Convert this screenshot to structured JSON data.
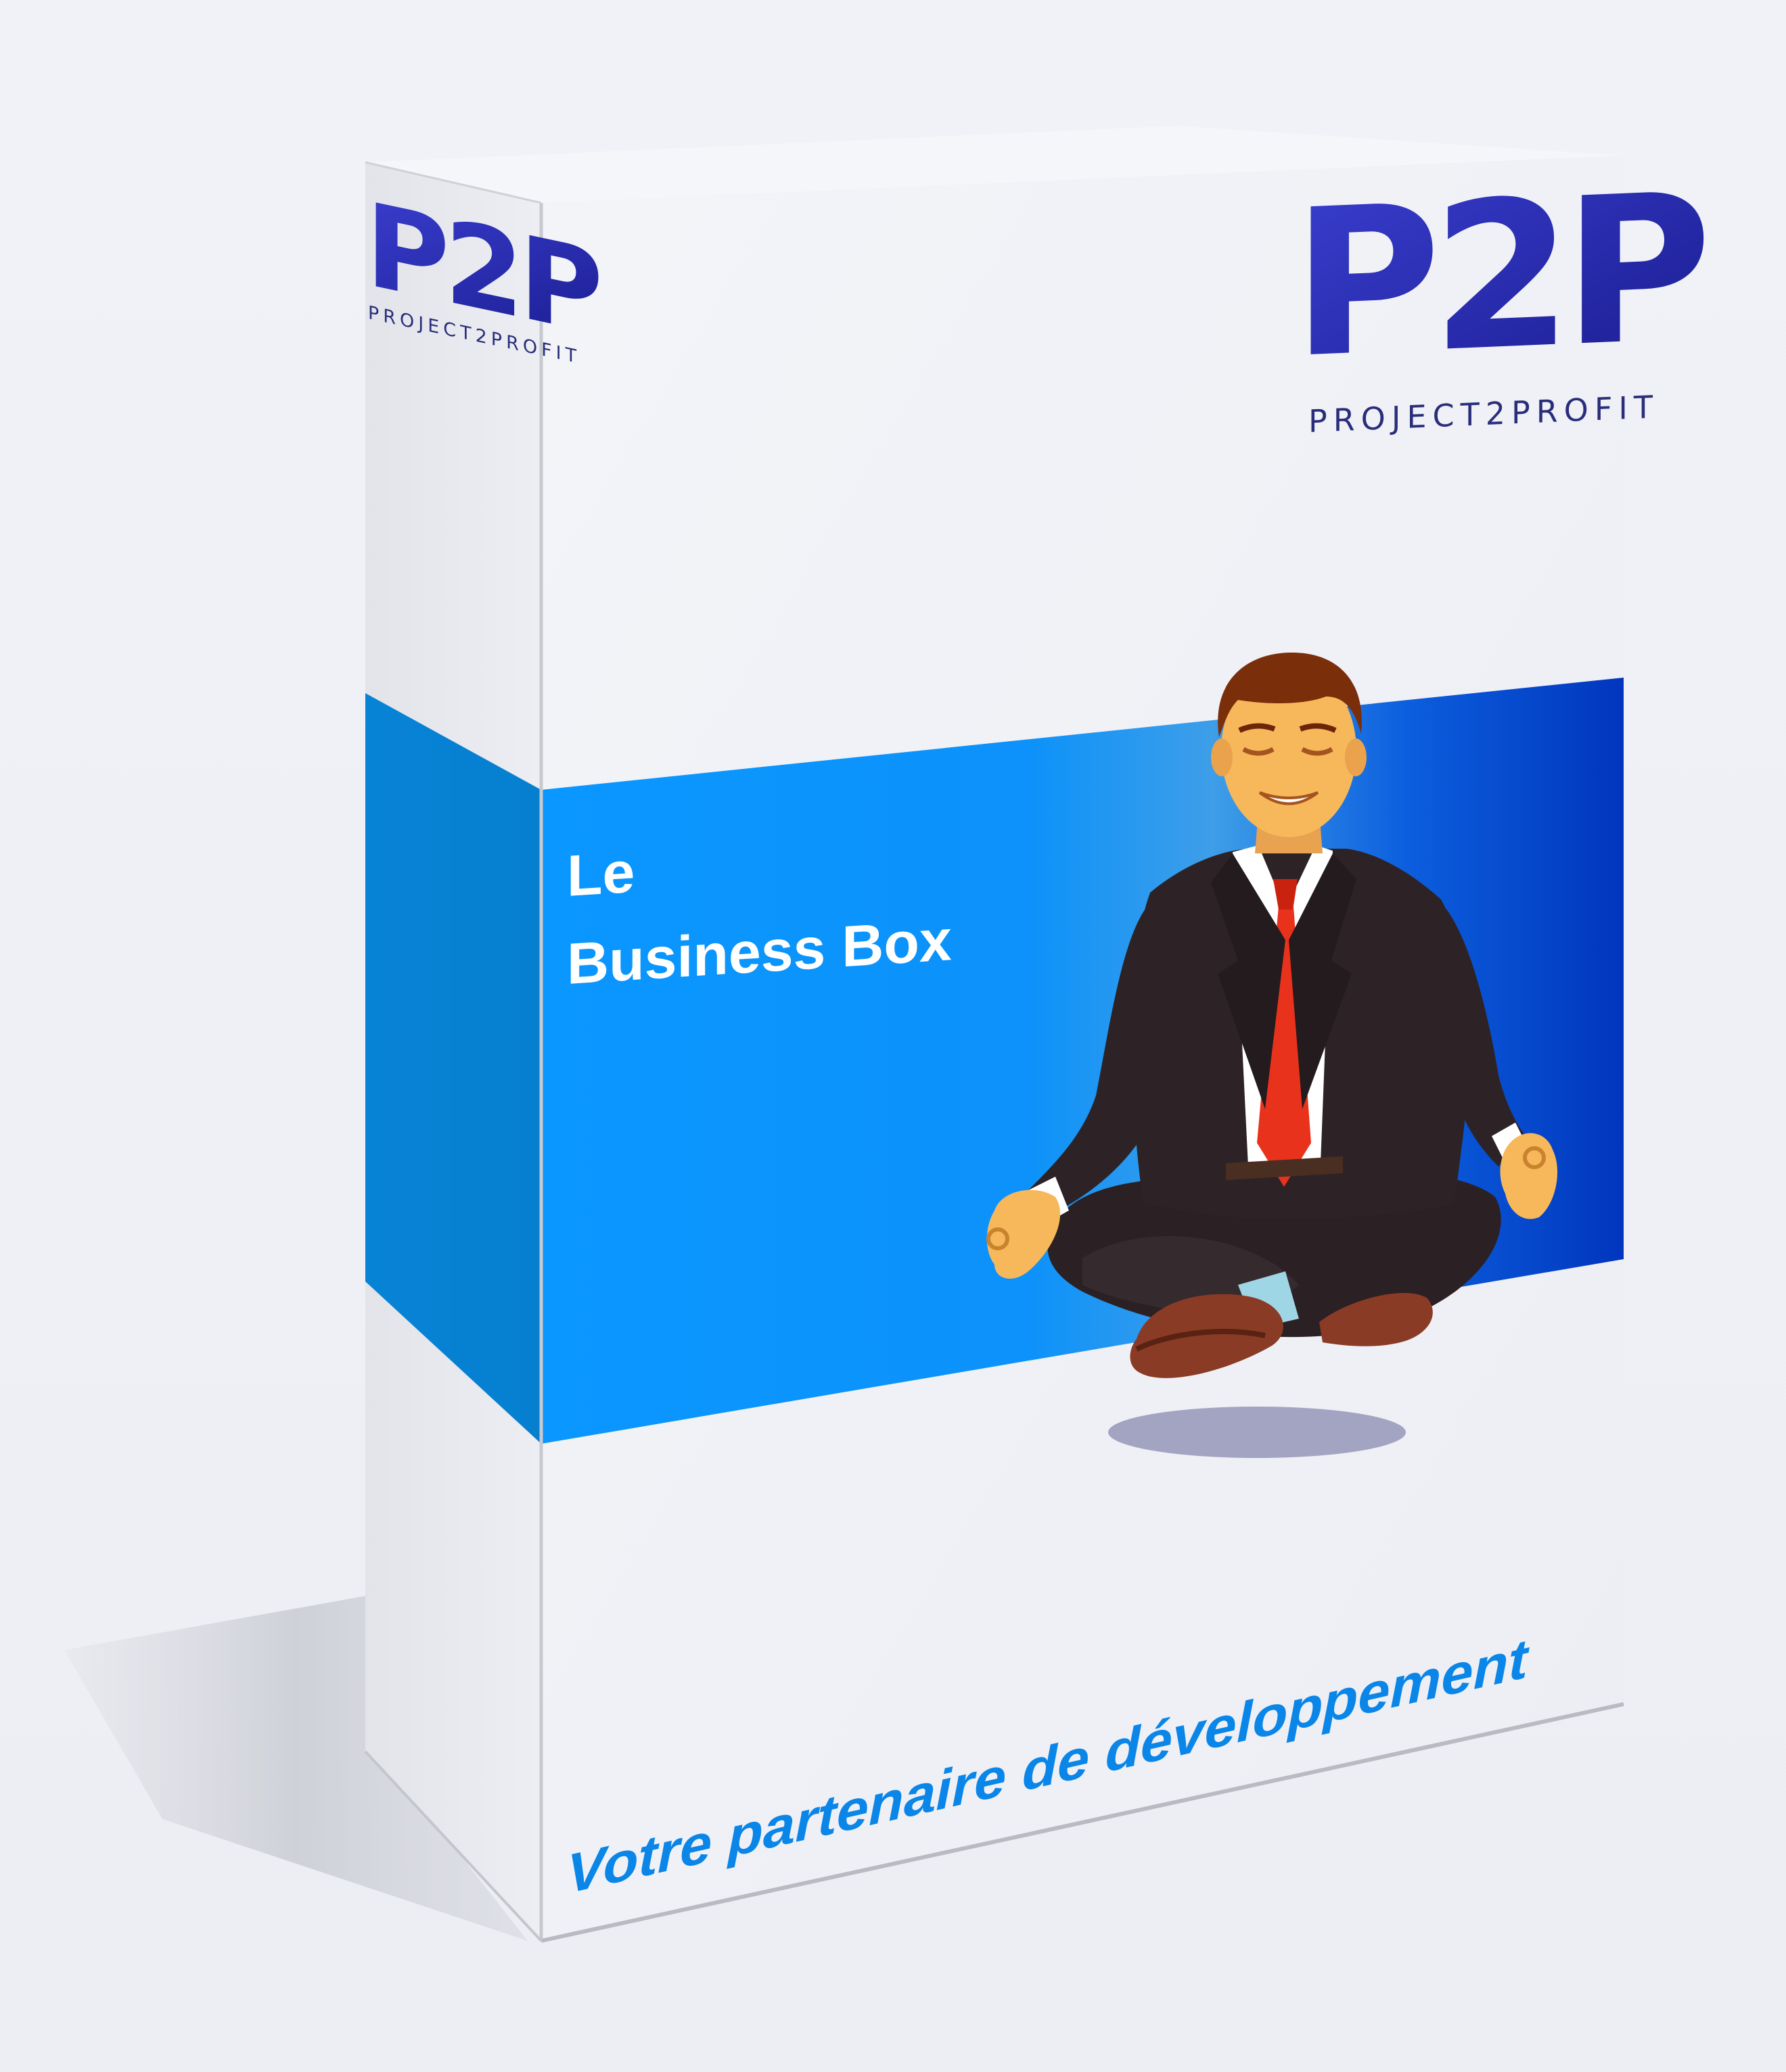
{
  "brand": {
    "logo_text": "P2P",
    "logo_subtitle": "PROJECT2PROFIT",
    "logo_color": "#2b2fb8"
  },
  "product": {
    "title_line1": "Le",
    "title_line2": "Business Box",
    "tagline": "Votre partenaire de développement"
  },
  "colors": {
    "band_light": "#0a97ff",
    "band_dark": "#0038c0",
    "tagline": "#0a85e8",
    "box_face": "#f0f1f6",
    "box_side": "#e4e6ec"
  },
  "illustration": {
    "subject": "meditating businessman in suit with red tie"
  }
}
